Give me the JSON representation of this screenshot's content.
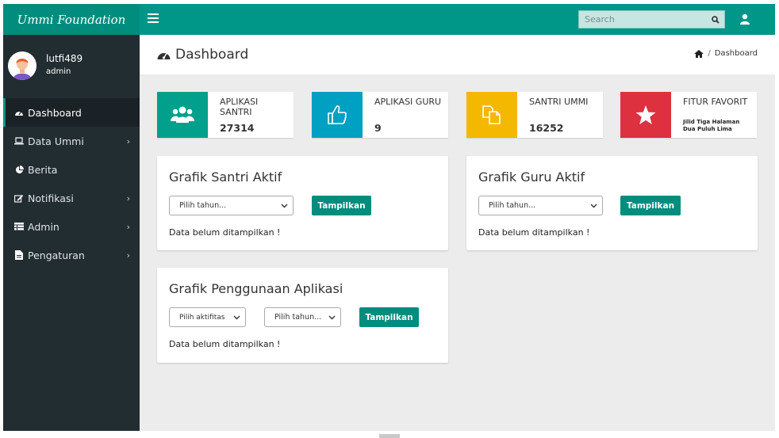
{
  "app": {
    "brand": "Ummi Foundation"
  },
  "search": {
    "placeholder": "Search"
  },
  "user": {
    "name": "lutfi489",
    "role": "admin"
  },
  "menu": [
    {
      "label": "Dashboard",
      "icon": "dashboard-icon",
      "active": true
    },
    {
      "label": "Data Ummi",
      "icon": "laptop-icon",
      "chevron": "›"
    },
    {
      "label": "Berita",
      "icon": "pie-chart-icon"
    },
    {
      "label": "Notifikasi",
      "icon": "edit-icon",
      "chevron": "›"
    },
    {
      "label": "Admin",
      "icon": "table-icon",
      "chevron": "›"
    },
    {
      "label": "Pengaturan",
      "icon": "file-icon",
      "chevron": "›"
    }
  ],
  "page": {
    "title": "Dashboard",
    "breadcrumb_sep": "/",
    "breadcrumb": "Dashboard"
  },
  "info_boxes": [
    {
      "label": "APLIKASI SANTRI",
      "value": "27314",
      "color": "#00a08c",
      "icon": "users-icon"
    },
    {
      "label": "APLIKASI GURU",
      "value": "9",
      "color": "#00a0c2",
      "icon": "thumbs-up-icon"
    },
    {
      "label": "SANTRI UMMI",
      "value": "16252",
      "color": "#f5b800",
      "icon": "copy-icon"
    },
    {
      "label": "FITUR FAVORIT",
      "subtext": "Jilid Tiga Halaman Dua Puluh Lima",
      "color": "#dd3140",
      "icon": "star-icon"
    }
  ],
  "panels": {
    "santri": {
      "title": "Grafik Santri Aktif",
      "select": "Pilih tahun...",
      "button": "Tampilkan",
      "message": "Data belum ditampilkan !"
    },
    "guru": {
      "title": "Grafik Guru Aktif",
      "select": "Pilih tahun...",
      "button": "Tampilkan",
      "message": "Data belum ditampilkan !"
    },
    "aplikasi": {
      "title": "Grafik Penggunaan Aplikasi",
      "select_activity": "Pilih aktifitas",
      "select_year": "Pilih tahun...",
      "button": "Tampilkan",
      "message": "Data belum ditampilkan !"
    }
  }
}
